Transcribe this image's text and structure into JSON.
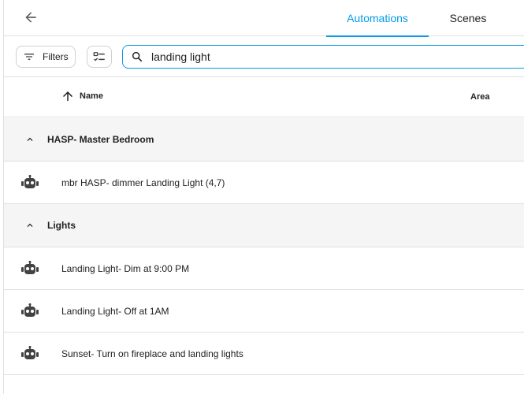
{
  "header": {
    "tabs": [
      {
        "label": "Automations",
        "active": true
      },
      {
        "label": "Scenes",
        "active": false
      }
    ]
  },
  "toolbar": {
    "filters_label": "Filters",
    "search_value": "landing light"
  },
  "table": {
    "columns": [
      "Name",
      "Area"
    ],
    "groups": [
      {
        "label": "HASP- Master Bedroom",
        "rows": [
          {
            "name": "mbr HASP- dimmer Landing Light (4,7)"
          }
        ]
      },
      {
        "label": "Lights",
        "rows": [
          {
            "name": "Landing Light- Dim at 9:00 PM"
          },
          {
            "name": "Landing Light- Off at 1AM"
          },
          {
            "name": "Sunset- Turn on fireplace and landing lights"
          }
        ]
      }
    ]
  },
  "colors": {
    "accent": "#039be5",
    "icon": "#424242",
    "divider": "#e0e0e0",
    "group_bg": "#f5f5f5"
  },
  "icons": {
    "back": "arrow-left-icon",
    "filters": "filter-icon",
    "select": "checklist-icon",
    "search": "search-icon",
    "sort": "arrow-up-icon",
    "collapse": "chevron-up-icon",
    "automation": "robot-icon"
  }
}
